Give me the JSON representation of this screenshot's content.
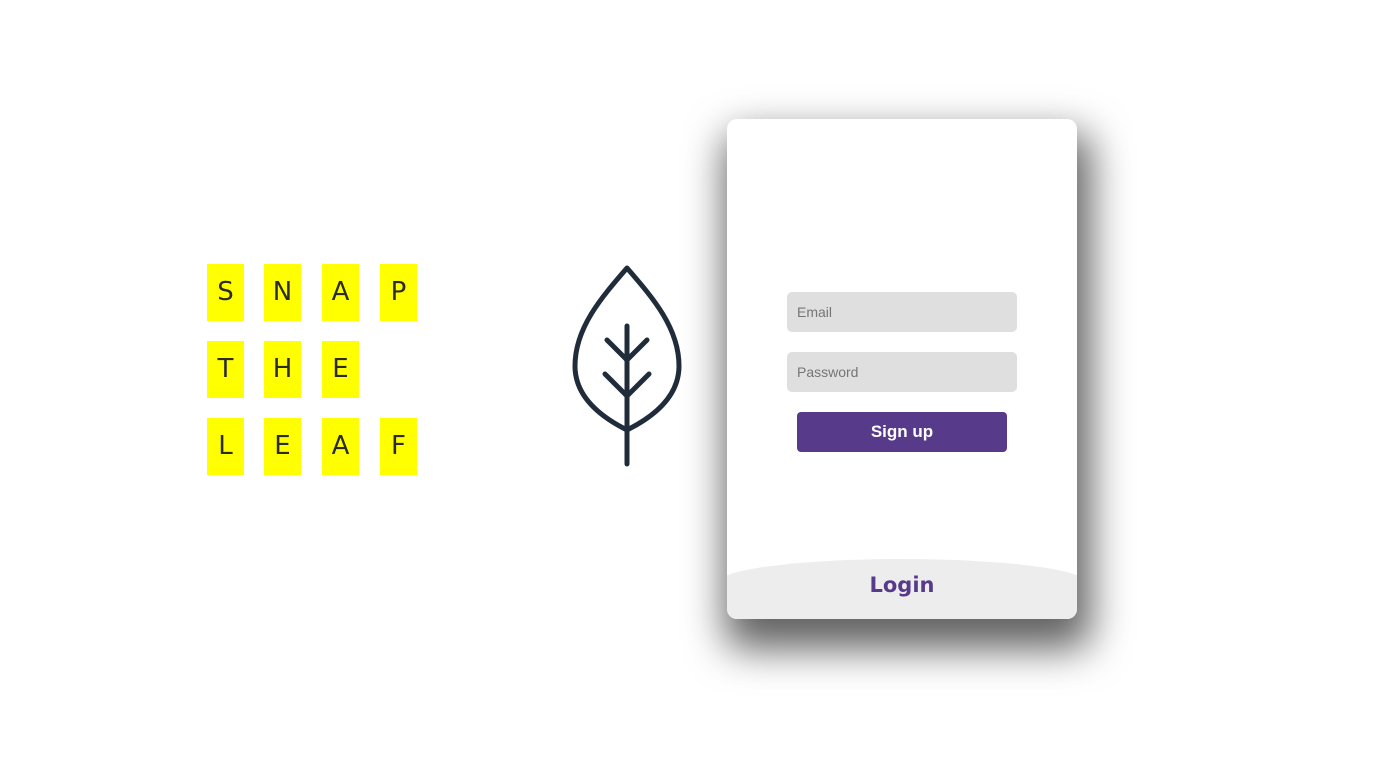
{
  "brand": {
    "rows": [
      [
        "S",
        "N",
        "A",
        "P"
      ],
      [
        "T",
        "H",
        "E"
      ],
      [
        "L",
        "E",
        "A",
        "F"
      ]
    ],
    "tile_color": "#ffff00",
    "logo_icon": "leaf-icon",
    "logo_color": "#212c3a"
  },
  "form": {
    "email_placeholder": "Email",
    "password_placeholder": "Password",
    "signup_label": "Sign up",
    "login_label": "Login"
  },
  "colors": {
    "accent": "#573b8a",
    "input_bg": "#e0dfe0",
    "login_panel_bg": "#ededed"
  }
}
